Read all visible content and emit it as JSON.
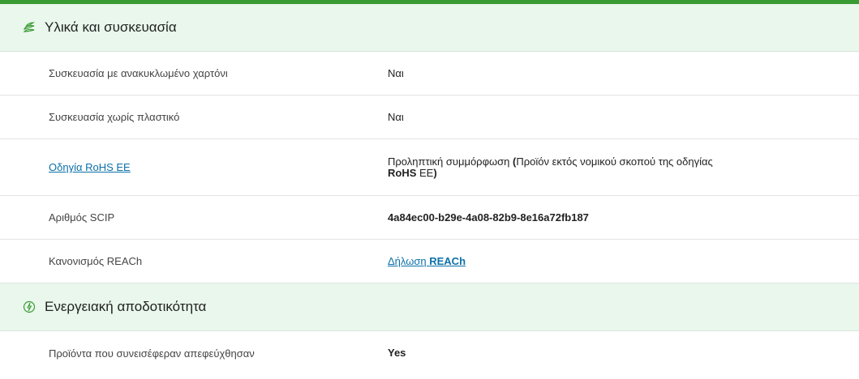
{
  "sections": [
    {
      "title": "Υλικά και συσκευασία",
      "icon": "leaves-icon",
      "rows": [
        {
          "label": "Συσκευασία με ανακυκλωμένο χαρτόνι",
          "value": "Ναι"
        },
        {
          "label": "Συσκευασία χωρίς πλαστικό",
          "value": "Ναι"
        },
        {
          "label": "Οδηγία RoHS EE",
          "value_parts": {
            "p1": "Προληπτική συμμόρφωση ",
            "p2": "(",
            "p3": "Προϊόν εκτός νομικού σκοπού της οδηγίας ",
            "p4": "RoHS",
            "p5": " ΕΕ",
            "p6": ")"
          }
        },
        {
          "label": "Αριθμός SCIP",
          "value": "4a84ec00-b29e-4a08-82b9-8e16a72fb187"
        },
        {
          "label": "Κανονισμός REACh",
          "value_parts": {
            "p1": "Δήλωση ",
            "p2": "REACh"
          }
        }
      ]
    },
    {
      "title": "Ενεργειακή αποδοτικότητα",
      "icon": "energy-leaf-icon",
      "rows": [
        {
          "label": "Προϊόντα που συνεισέφεραν απεφεύχθησαν",
          "value": "Yes"
        }
      ]
    }
  ],
  "colors": {
    "accent": "#3a9b35",
    "header_bg": "#e9f7ec",
    "link": "#0b70a8"
  }
}
